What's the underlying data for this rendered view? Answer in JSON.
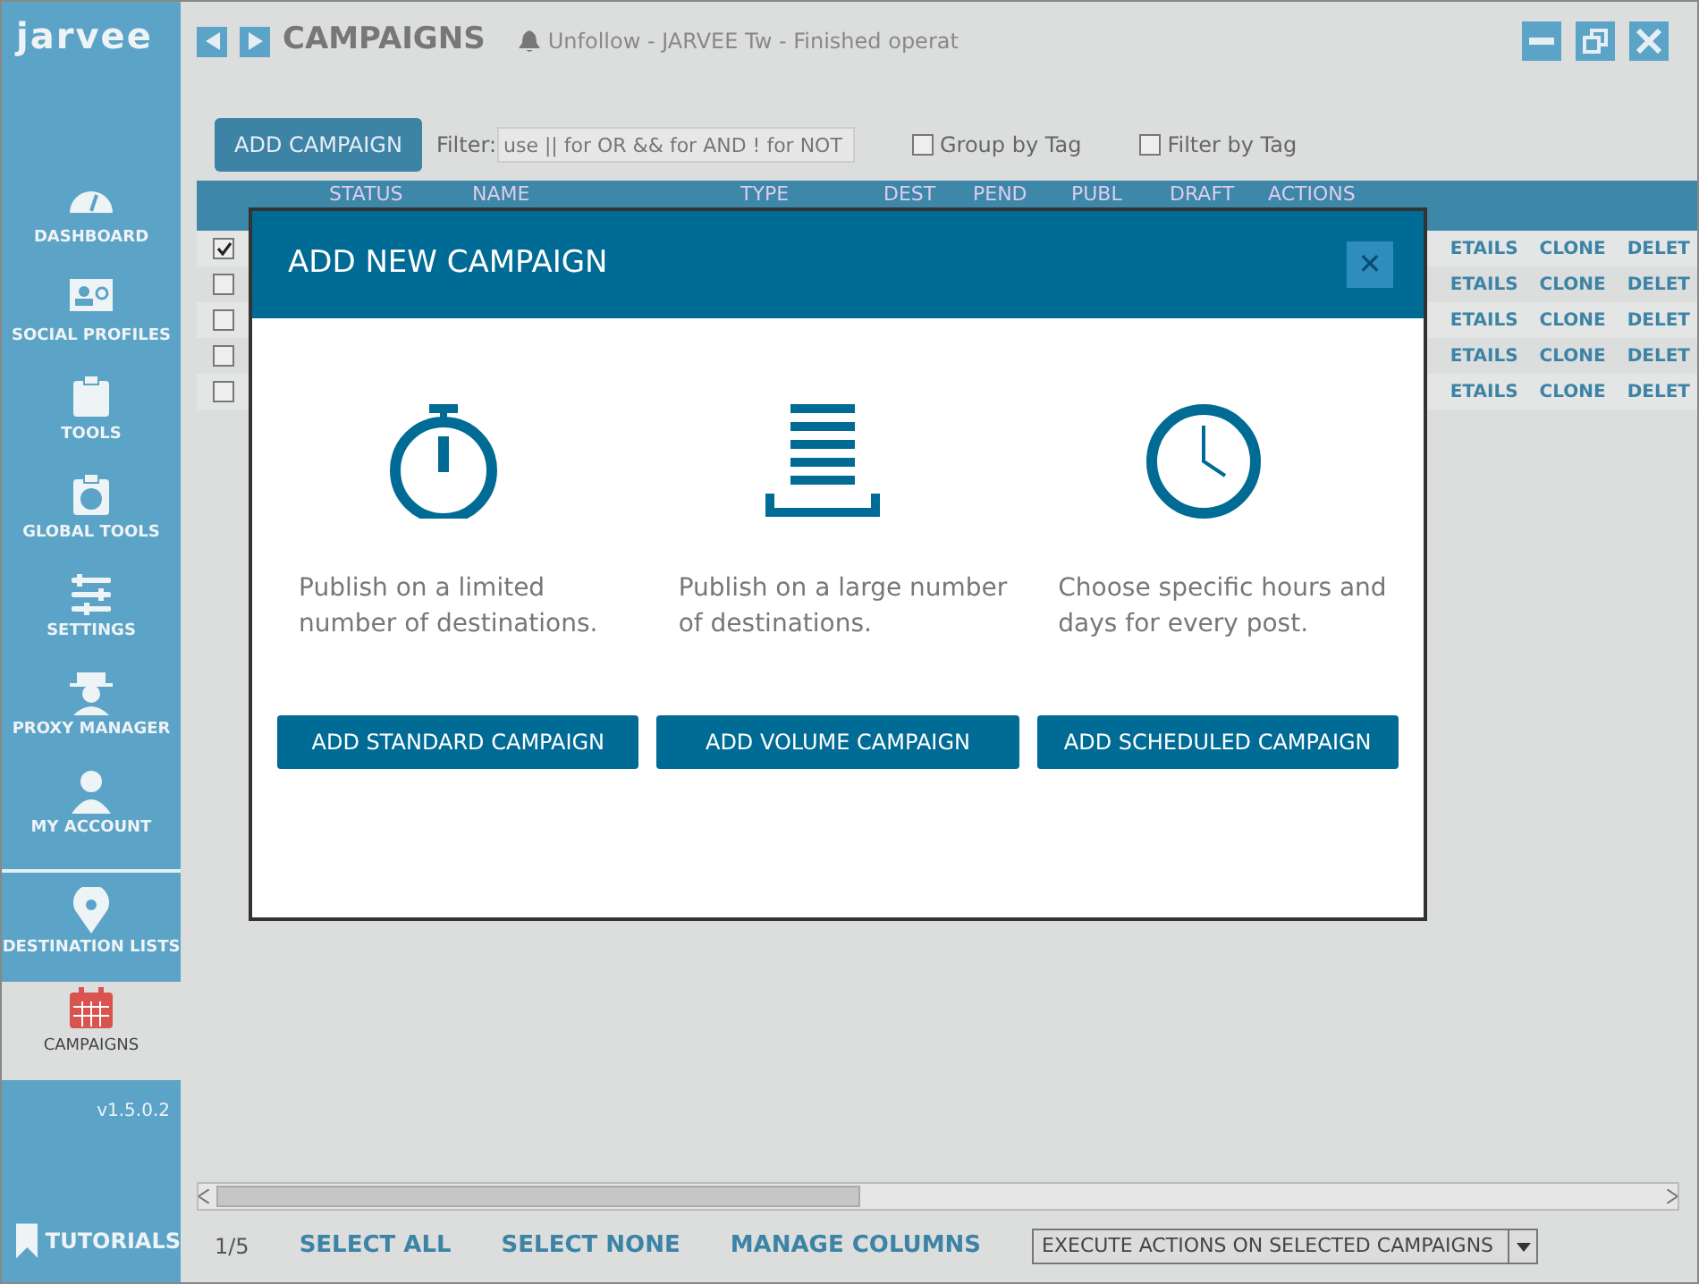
{
  "app": {
    "logo": "jarvee",
    "title": "CAMPAIGNS",
    "notification": "Unfollow - JARVEE Tw - Finished operat"
  },
  "sidebar": {
    "items": [
      {
        "label": "DASHBOARD",
        "selected": false
      },
      {
        "label": "SOCIAL PROFILES",
        "selected": false
      },
      {
        "label": "TOOLS",
        "selected": false
      },
      {
        "label": "GLOBAL TOOLS",
        "selected": false
      },
      {
        "label": "SETTINGS",
        "selected": false
      },
      {
        "label": "PROXY MANAGER",
        "selected": false
      },
      {
        "label": "MY ACCOUNT",
        "selected": false
      },
      {
        "label": "DESTINATION LISTS",
        "selected": false
      },
      {
        "label": "CAMPAIGNS",
        "selected": true
      }
    ],
    "version": "v1.5.0.2",
    "tutorials": "TUTORIALS"
  },
  "toolbar": {
    "add_button": "ADD CAMPAIGN",
    "filter_label": "Filter:",
    "filter_placeholder": "use || for OR && for AND ! for NOT",
    "checkboxes": [
      {
        "label": "Group by Tag",
        "checked": false
      },
      {
        "label": "Filter by Tag",
        "checked": false
      }
    ]
  },
  "table": {
    "columns": [
      "STATUS",
      "NAME",
      "TYPE",
      "DEST",
      "PEND",
      "PUBL",
      "DRAFT",
      "ACTIONS"
    ],
    "rows": [
      {
        "checked": true,
        "actions": [
          "ETAILS",
          "CLONE",
          "DELET"
        ]
      },
      {
        "checked": false,
        "actions": [
          "ETAILS",
          "CLONE",
          "DELET"
        ]
      },
      {
        "checked": false,
        "actions": [
          "ETAILS",
          "CLONE",
          "DELET"
        ]
      },
      {
        "checked": false,
        "actions": [
          "ETAILS",
          "CLONE",
          "DELET"
        ]
      },
      {
        "checked": false,
        "actions": [
          "ETAILS",
          "CLONE",
          "DELET"
        ]
      }
    ]
  },
  "footer": {
    "count": "1/5",
    "links": [
      "SELECT ALL",
      "SELECT NONE",
      "MANAGE COLUMNS"
    ],
    "action_dropdown": "EXECUTE ACTIONS ON SELECTED CAMPAIGNS"
  },
  "modal": {
    "title": "ADD NEW CAMPAIGN",
    "close": "✕",
    "options": [
      {
        "description": "Publish on a limited number of destinations.",
        "button": "ADD STANDARD CAMPAIGN"
      },
      {
        "description": "Publish on a large number of destinations.",
        "button": "ADD VOLUME CAMPAIGN"
      },
      {
        "description": "Choose specific hours and days for every post.",
        "button": "ADD SCHEDULED CAMPAIGN"
      }
    ]
  }
}
